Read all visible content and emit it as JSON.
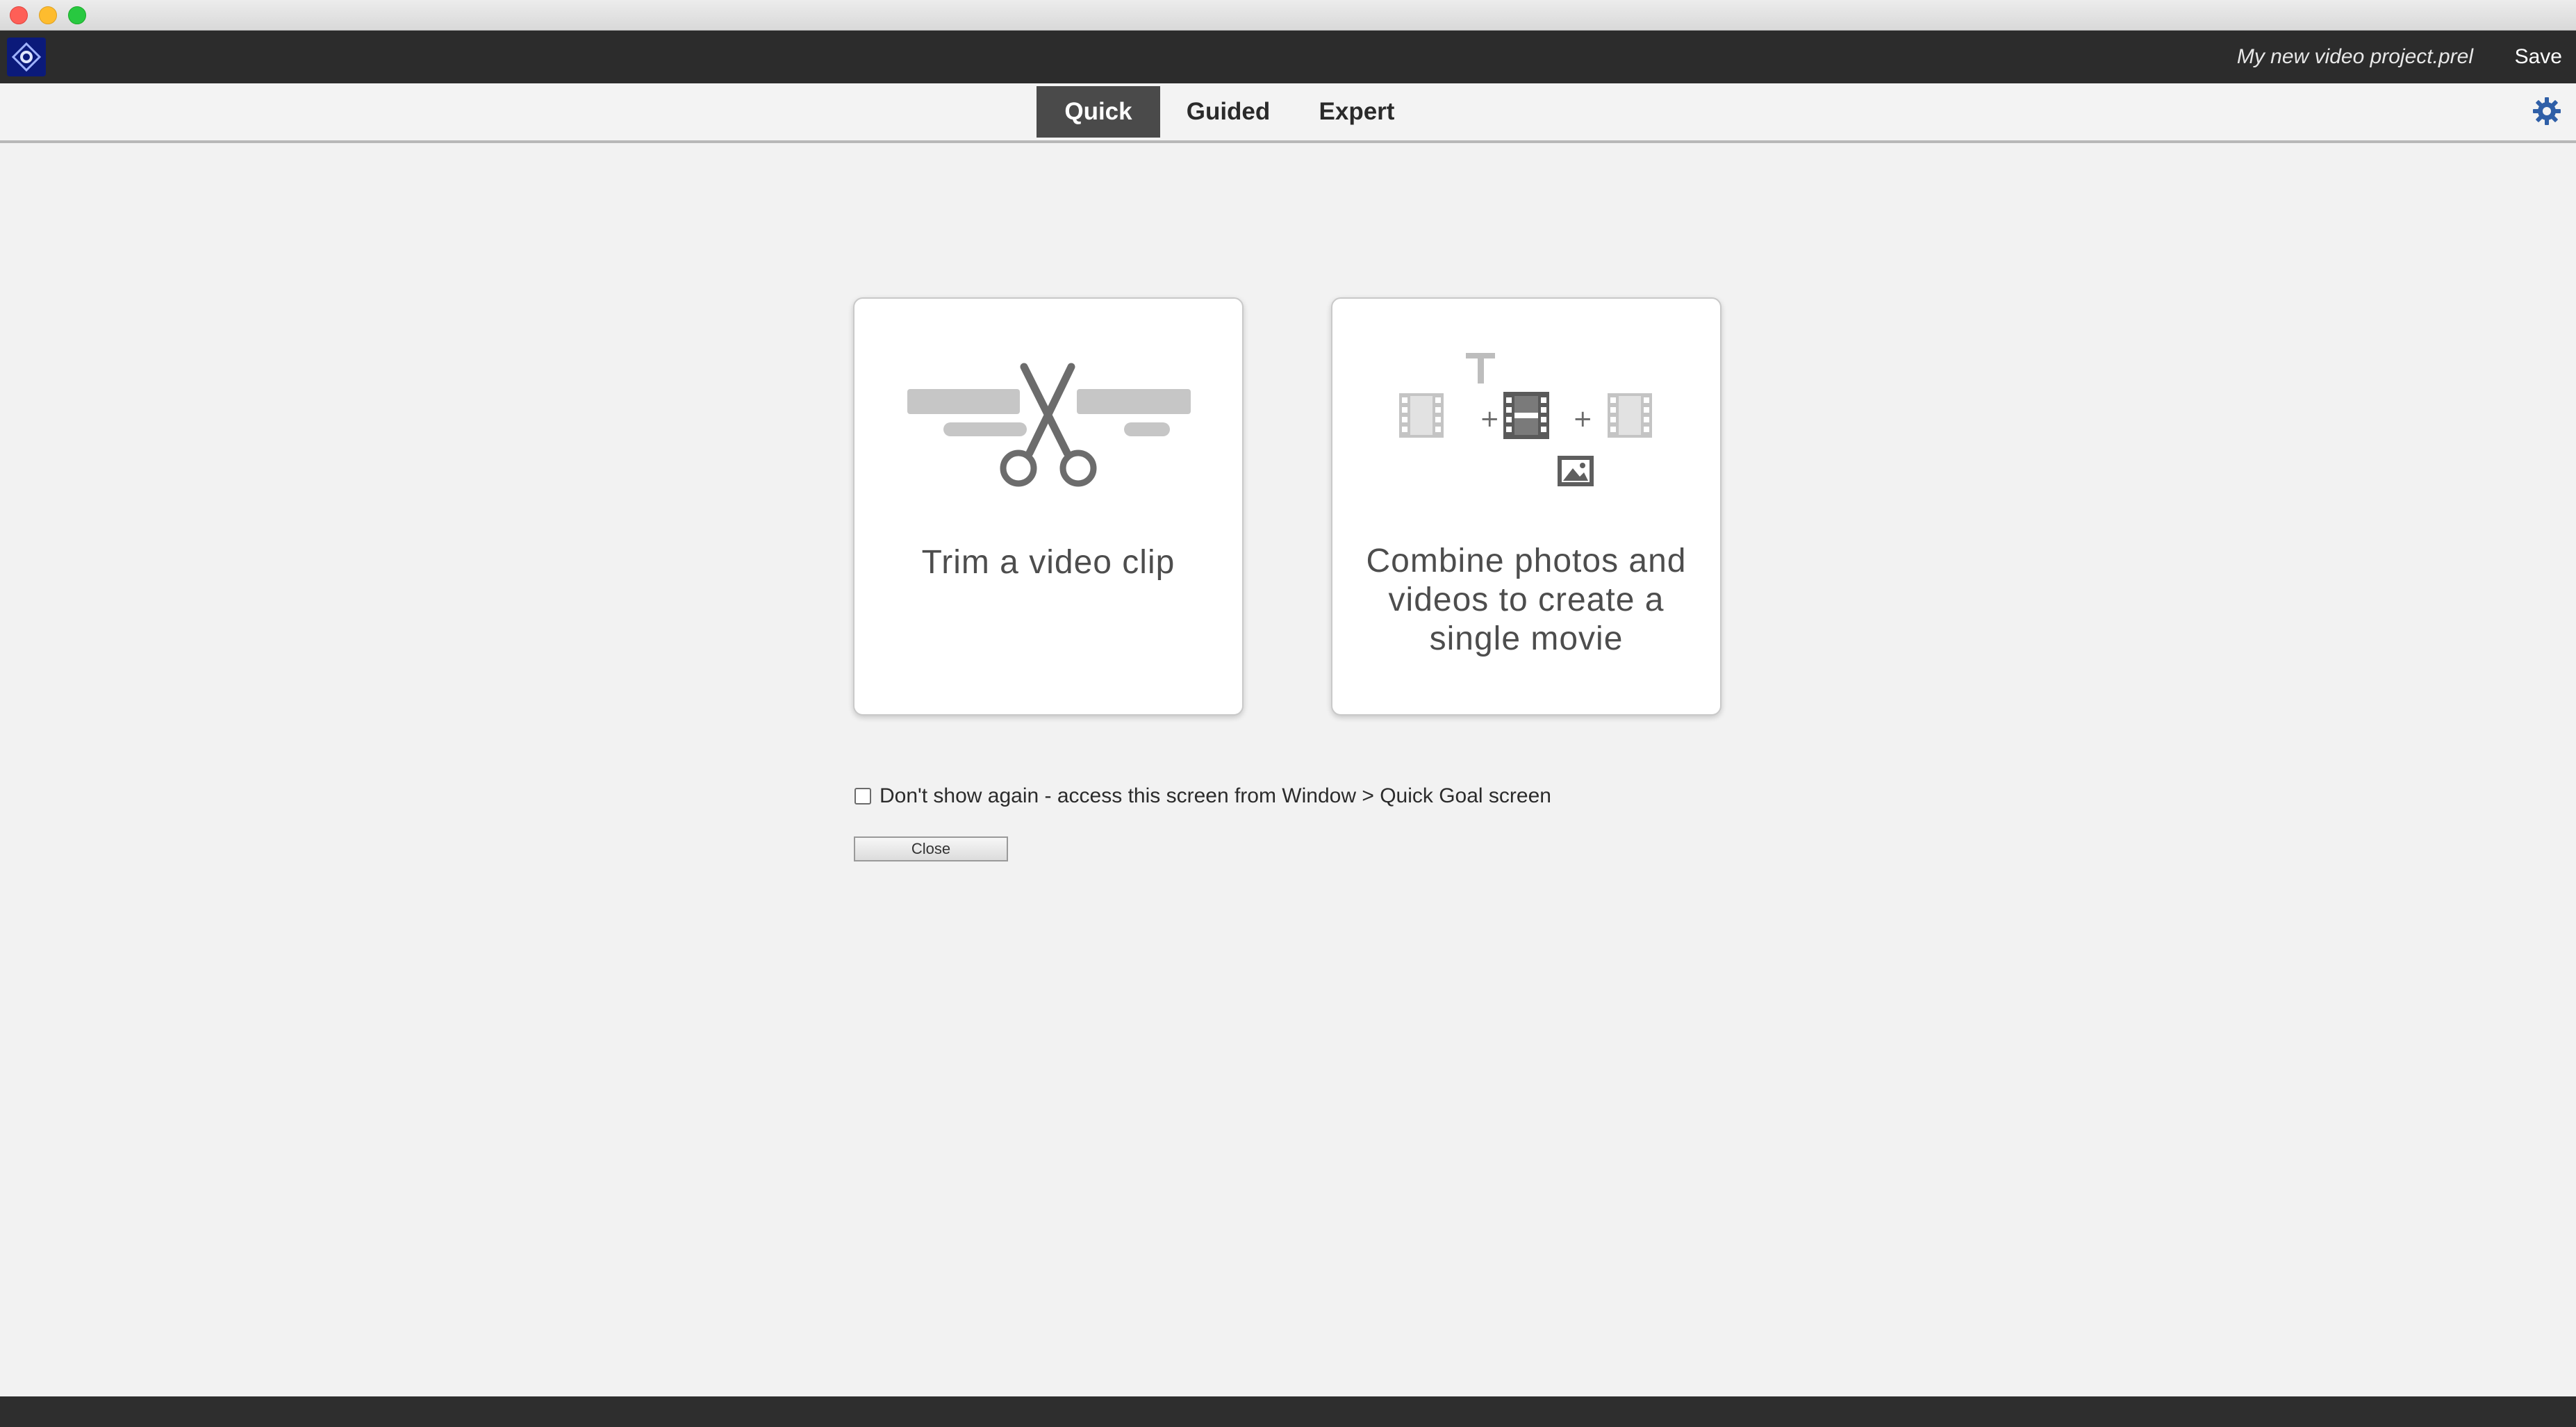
{
  "window": {
    "controls": [
      "close",
      "minimize",
      "zoom"
    ]
  },
  "header": {
    "logo_icon": "premiere-elements-logo-icon",
    "project_name": "My new video project.prel",
    "save_label": "Save"
  },
  "tabs": [
    {
      "label": "Quick",
      "active": true
    },
    {
      "label": "Guided",
      "active": false
    },
    {
      "label": "Expert",
      "active": false
    }
  ],
  "settings_icon": "gear-icon",
  "cards": [
    {
      "label": "Trim a video clip",
      "icon": "scissors-icon"
    },
    {
      "label": "Combine photos and videos to create a single movie",
      "icon": "combine-media-icon"
    }
  ],
  "dont_show": {
    "checked": false,
    "label": "Don't show again - access this screen from Window > Quick Goal screen"
  },
  "close_button": {
    "label": "Close"
  },
  "colors": {
    "app_bar": "#2c2c2c",
    "active_tab": "#4a4a4a",
    "logo": "#0b1a7a",
    "gear": "#2f5fa7"
  }
}
